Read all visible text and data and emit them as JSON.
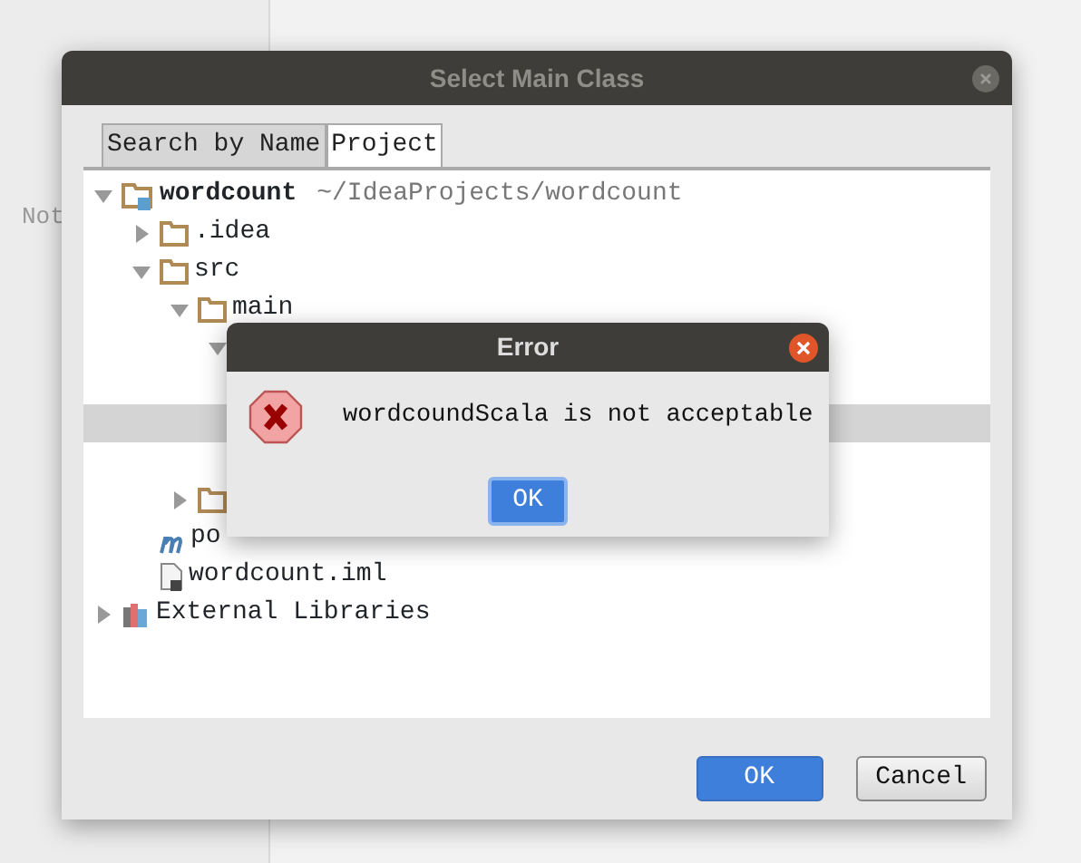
{
  "background": {
    "label": "Not"
  },
  "dialog": {
    "title": "Select Main Class",
    "tabs": [
      {
        "label": "Search by Name",
        "selected": false
      },
      {
        "label": "Project",
        "selected": true
      }
    ],
    "tree": [
      {
        "kind": "module",
        "label": "wordcount",
        "suffix": "~/IdeaProjects/wordcount",
        "expanded": true,
        "selected": false,
        "children": [
          {
            "kind": "folder",
            "label": ".idea",
            "expanded": false,
            "selected": false
          },
          {
            "kind": "folder",
            "label": "src",
            "expanded": true,
            "selected": false,
            "children": [
              {
                "kind": "folder",
                "label": "main",
                "expanded": true,
                "selected": false,
                "children": [
                  {
                    "expanded": true,
                    "selected": false,
                    "children": [
                      {
                        "selected": false
                      },
                      {
                        "selected": true
                      },
                      {
                        "selected": false
                      }
                    ]
                  }
                ]
              },
              {
                "kind": "folder",
                "expanded": false,
                "selected": false
              }
            ]
          },
          {
            "kind": "maven",
            "label": "po",
            "selected": false
          },
          {
            "kind": "file",
            "label": "wordcount.iml",
            "selected": false
          }
        ]
      },
      {
        "kind": "library",
        "label": "External Libraries",
        "expanded": false,
        "selected": false
      }
    ],
    "buttons": [
      {
        "label": "OK",
        "kind": "primary"
      },
      {
        "label": "Cancel",
        "kind": "default"
      }
    ]
  },
  "error_dialog": {
    "title": "Error",
    "message": "wordcoundScala is not acceptable",
    "button": "OK"
  }
}
